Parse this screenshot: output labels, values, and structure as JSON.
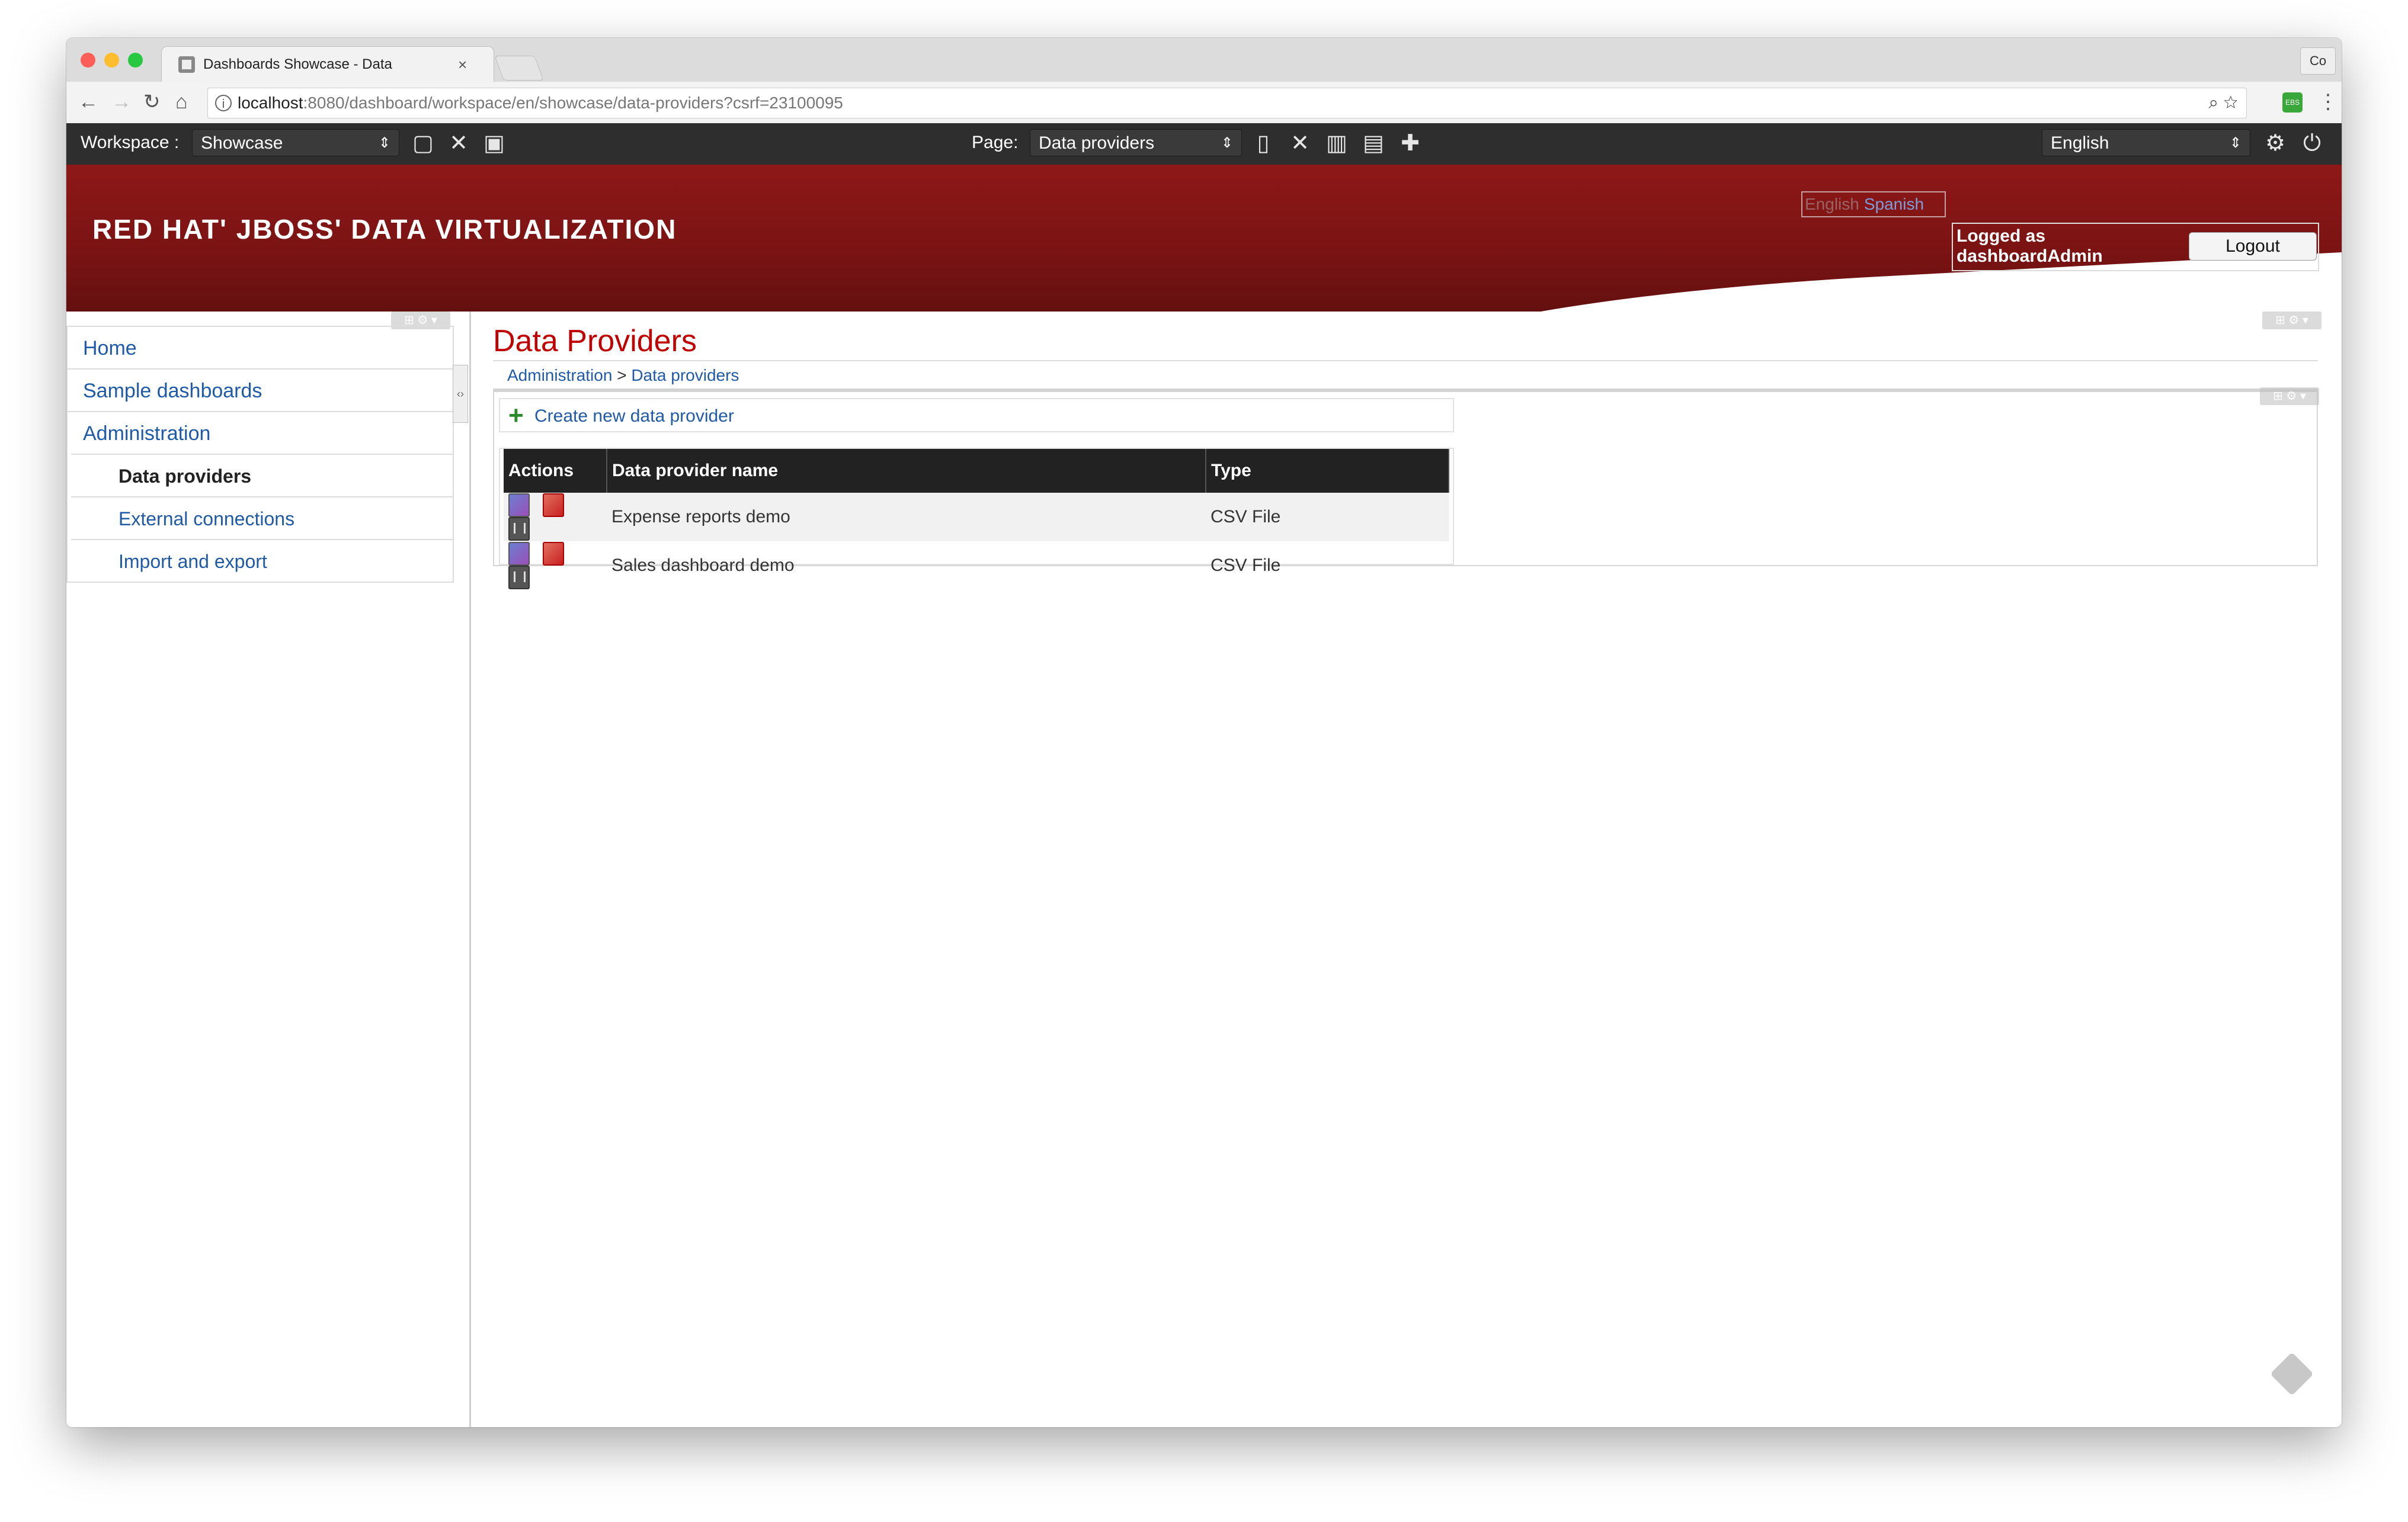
{
  "browser": {
    "tab_title": "Dashboards Showcase - Data",
    "tab_close": "×",
    "profile_label": "Co",
    "url_host": "localhost",
    "url_rest": ":8080/dashboard/workspace/en/showcase/data-providers?csrf=23100095",
    "ext_label": "EBS"
  },
  "toolbar": {
    "workspace_label": "Workspace :",
    "workspace_value": "Showcase",
    "page_label": "Page:",
    "page_value": "Data providers",
    "language_value": "English"
  },
  "banner": {
    "logo": "RED HAT' JBOSS' DATA VIRTUALIZATION",
    "lang_english": "English",
    "lang_spanish": "Spanish",
    "logged_as": "Logged as dashboardAdmin",
    "logout_label": "Logout"
  },
  "nav": {
    "items": [
      {
        "label": "Home"
      },
      {
        "label": "Sample dashboards"
      },
      {
        "label": "Administration"
      },
      {
        "label": "Data providers"
      },
      {
        "label": "External connections"
      },
      {
        "label": "Import and export"
      }
    ]
  },
  "main": {
    "title": "Data Providers",
    "breadcrumb_parent": "Administration",
    "breadcrumb_sep": ">",
    "breadcrumb_current": "Data providers",
    "create_label": "Create new data provider",
    "table": {
      "columns": [
        "Actions",
        "Data provider name",
        "Type"
      ],
      "rows": [
        {
          "name": "Expense reports demo",
          "type": "CSV File"
        },
        {
          "name": "Sales dashboard demo",
          "type": "CSV File"
        }
      ]
    }
  },
  "icons": {
    "back": "back-arrow-icon",
    "forward": "forward-arrow-icon",
    "reload": "reload-icon",
    "home": "home-icon",
    "zoom": "zoom-icon",
    "bookmark": "star-icon",
    "menu": "kebab-menu-icon",
    "gear": "gear-icon",
    "power": "power-icon"
  },
  "colors": {
    "banner_red": "#7a1313",
    "title_red": "#c00000",
    "link_blue": "#1f5aa6",
    "toolbar_dark": "#2e2e2e"
  }
}
